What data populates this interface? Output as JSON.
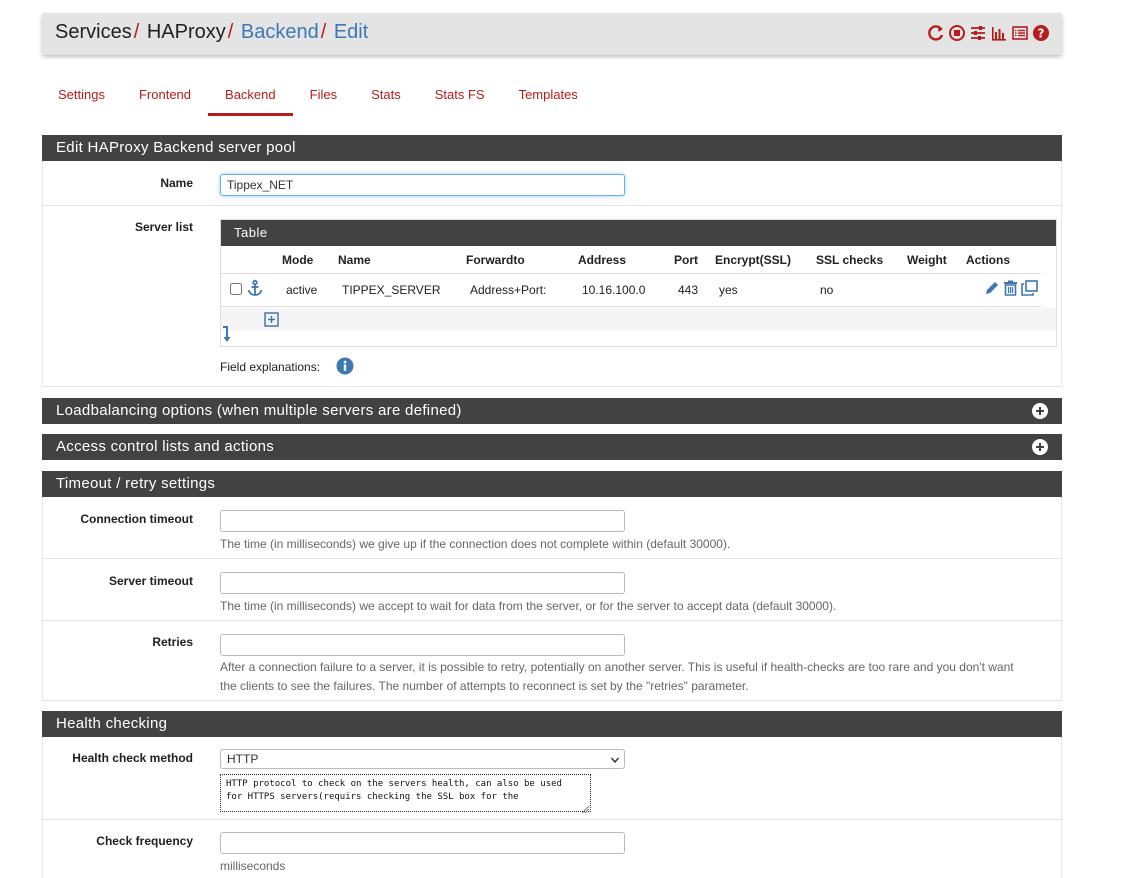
{
  "breadcrumb": {
    "items": [
      "Services",
      "HAProxy",
      "Backend",
      "Edit"
    ],
    "separator": "/"
  },
  "header_icons": [
    "restart-icon",
    "stop-icon",
    "sliders-icon",
    "bar-chart-icon",
    "log-list-icon",
    "help-icon"
  ],
  "tabs": [
    {
      "label": "Settings",
      "active": false
    },
    {
      "label": "Frontend",
      "active": false
    },
    {
      "label": "Backend",
      "active": true
    },
    {
      "label": "Files",
      "active": false
    },
    {
      "label": "Stats",
      "active": false
    },
    {
      "label": "Stats FS",
      "active": false
    },
    {
      "label": "Templates",
      "active": false
    }
  ],
  "panels": {
    "edit_pool": "Edit HAProxy Backend server pool",
    "loadbalancing": "Loadbalancing options (when multiple servers are defined)",
    "acl": "Access control lists and actions",
    "timeout": "Timeout / retry settings",
    "health": "Health checking"
  },
  "name_field": {
    "label": "Name",
    "value": "Tippex_NET"
  },
  "server_list": {
    "label": "Server list",
    "table_title": "Table",
    "columns": [
      "Mode",
      "Name",
      "Forwardto",
      "Address",
      "Port",
      "Encrypt(SSL)",
      "SSL checks",
      "Weight",
      "Actions"
    ],
    "rows": [
      {
        "mode": "active",
        "name": "TIPPEX_SERVER",
        "forwardto": "Address+Port:",
        "address": "10.16.100.0",
        "port": "443",
        "encrypt": "yes",
        "ssl_checks": "no",
        "weight": ""
      }
    ],
    "field_explanations": "Field explanations:"
  },
  "timeouts": {
    "connection": {
      "label": "Connection timeout",
      "value": "",
      "help": "The time (in milliseconds) we give up if the connection does not complete within (default 30000)."
    },
    "server": {
      "label": "Server timeout",
      "value": "",
      "help": "The time (in milliseconds) we accept to wait for data from the server, or for the server to accept data (default 30000)."
    },
    "retries": {
      "label": "Retries",
      "value": "",
      "help_line1": "After a connection failure to a server, it is possible to retry, potentially on another server. This is useful if health-checks are too rare and you don't want",
      "help_line2": "the clients to see the failures. The number of attempts to reconnect is set by the \"retries\" parameter."
    }
  },
  "health": {
    "method_label": "Health check method",
    "method_value": "HTTP",
    "method_desc": "HTTP protocol to check on the servers health, can also be used\nfor HTTPS servers(requirs checking the SSL box for the",
    "frequency_label": "Check frequency",
    "frequency_value": "",
    "frequency_help": "milliseconds"
  },
  "colors": {
    "accent": "#b71c1c",
    "link": "#3c78b4",
    "panel_header": "#424242"
  }
}
